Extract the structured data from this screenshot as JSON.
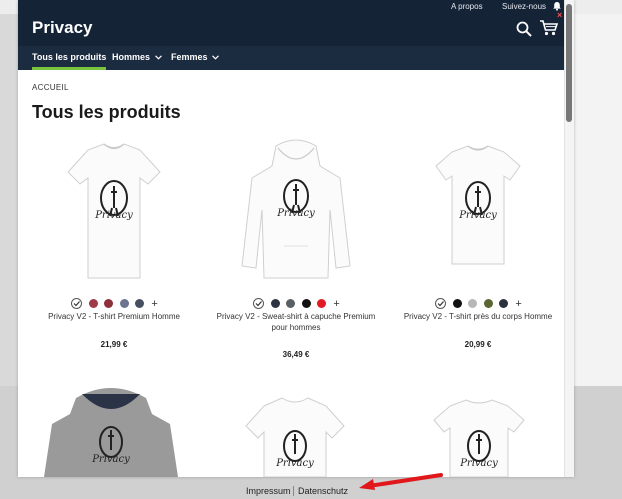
{
  "store": {
    "brand": "Privacy"
  },
  "toplinks": {
    "about": "A propos",
    "follow": "Suivez-nous"
  },
  "nav": {
    "items": [
      {
        "label": "Tous les produits"
      },
      {
        "label": "Hommes"
      },
      {
        "label": "Femmes"
      }
    ]
  },
  "breadcrumb": "ACCUEIL",
  "title": "Tous les produits",
  "products": [
    {
      "name": "Privacy V2 - T-shirt Premium Homme",
      "price": "21,99 €",
      "swatches": [
        "#ffffff",
        "#9e3a49",
        "#8e2f3c",
        "#6b7590",
        "#475060"
      ]
    },
    {
      "name": "Privacy V2 - Sweat-shirt à capuche Premium pour hommes",
      "price": "36,49 €",
      "swatches": [
        "#ffffff",
        "#2c3443",
        "#5a5f66",
        "#111111",
        "#e01b24"
      ]
    },
    {
      "name": "Privacy V2 - T-shirt près du corps Homme",
      "price": "20,99 €",
      "swatches": [
        "#ffffff",
        "#111111",
        "#b7b7b7",
        "#5a6632",
        "#2b3140"
      ]
    }
  ],
  "footer": {
    "impressum": "Impressum",
    "datenschutz": "Datenschutz"
  },
  "accent": "#79c33f",
  "header_bg": "#152337"
}
